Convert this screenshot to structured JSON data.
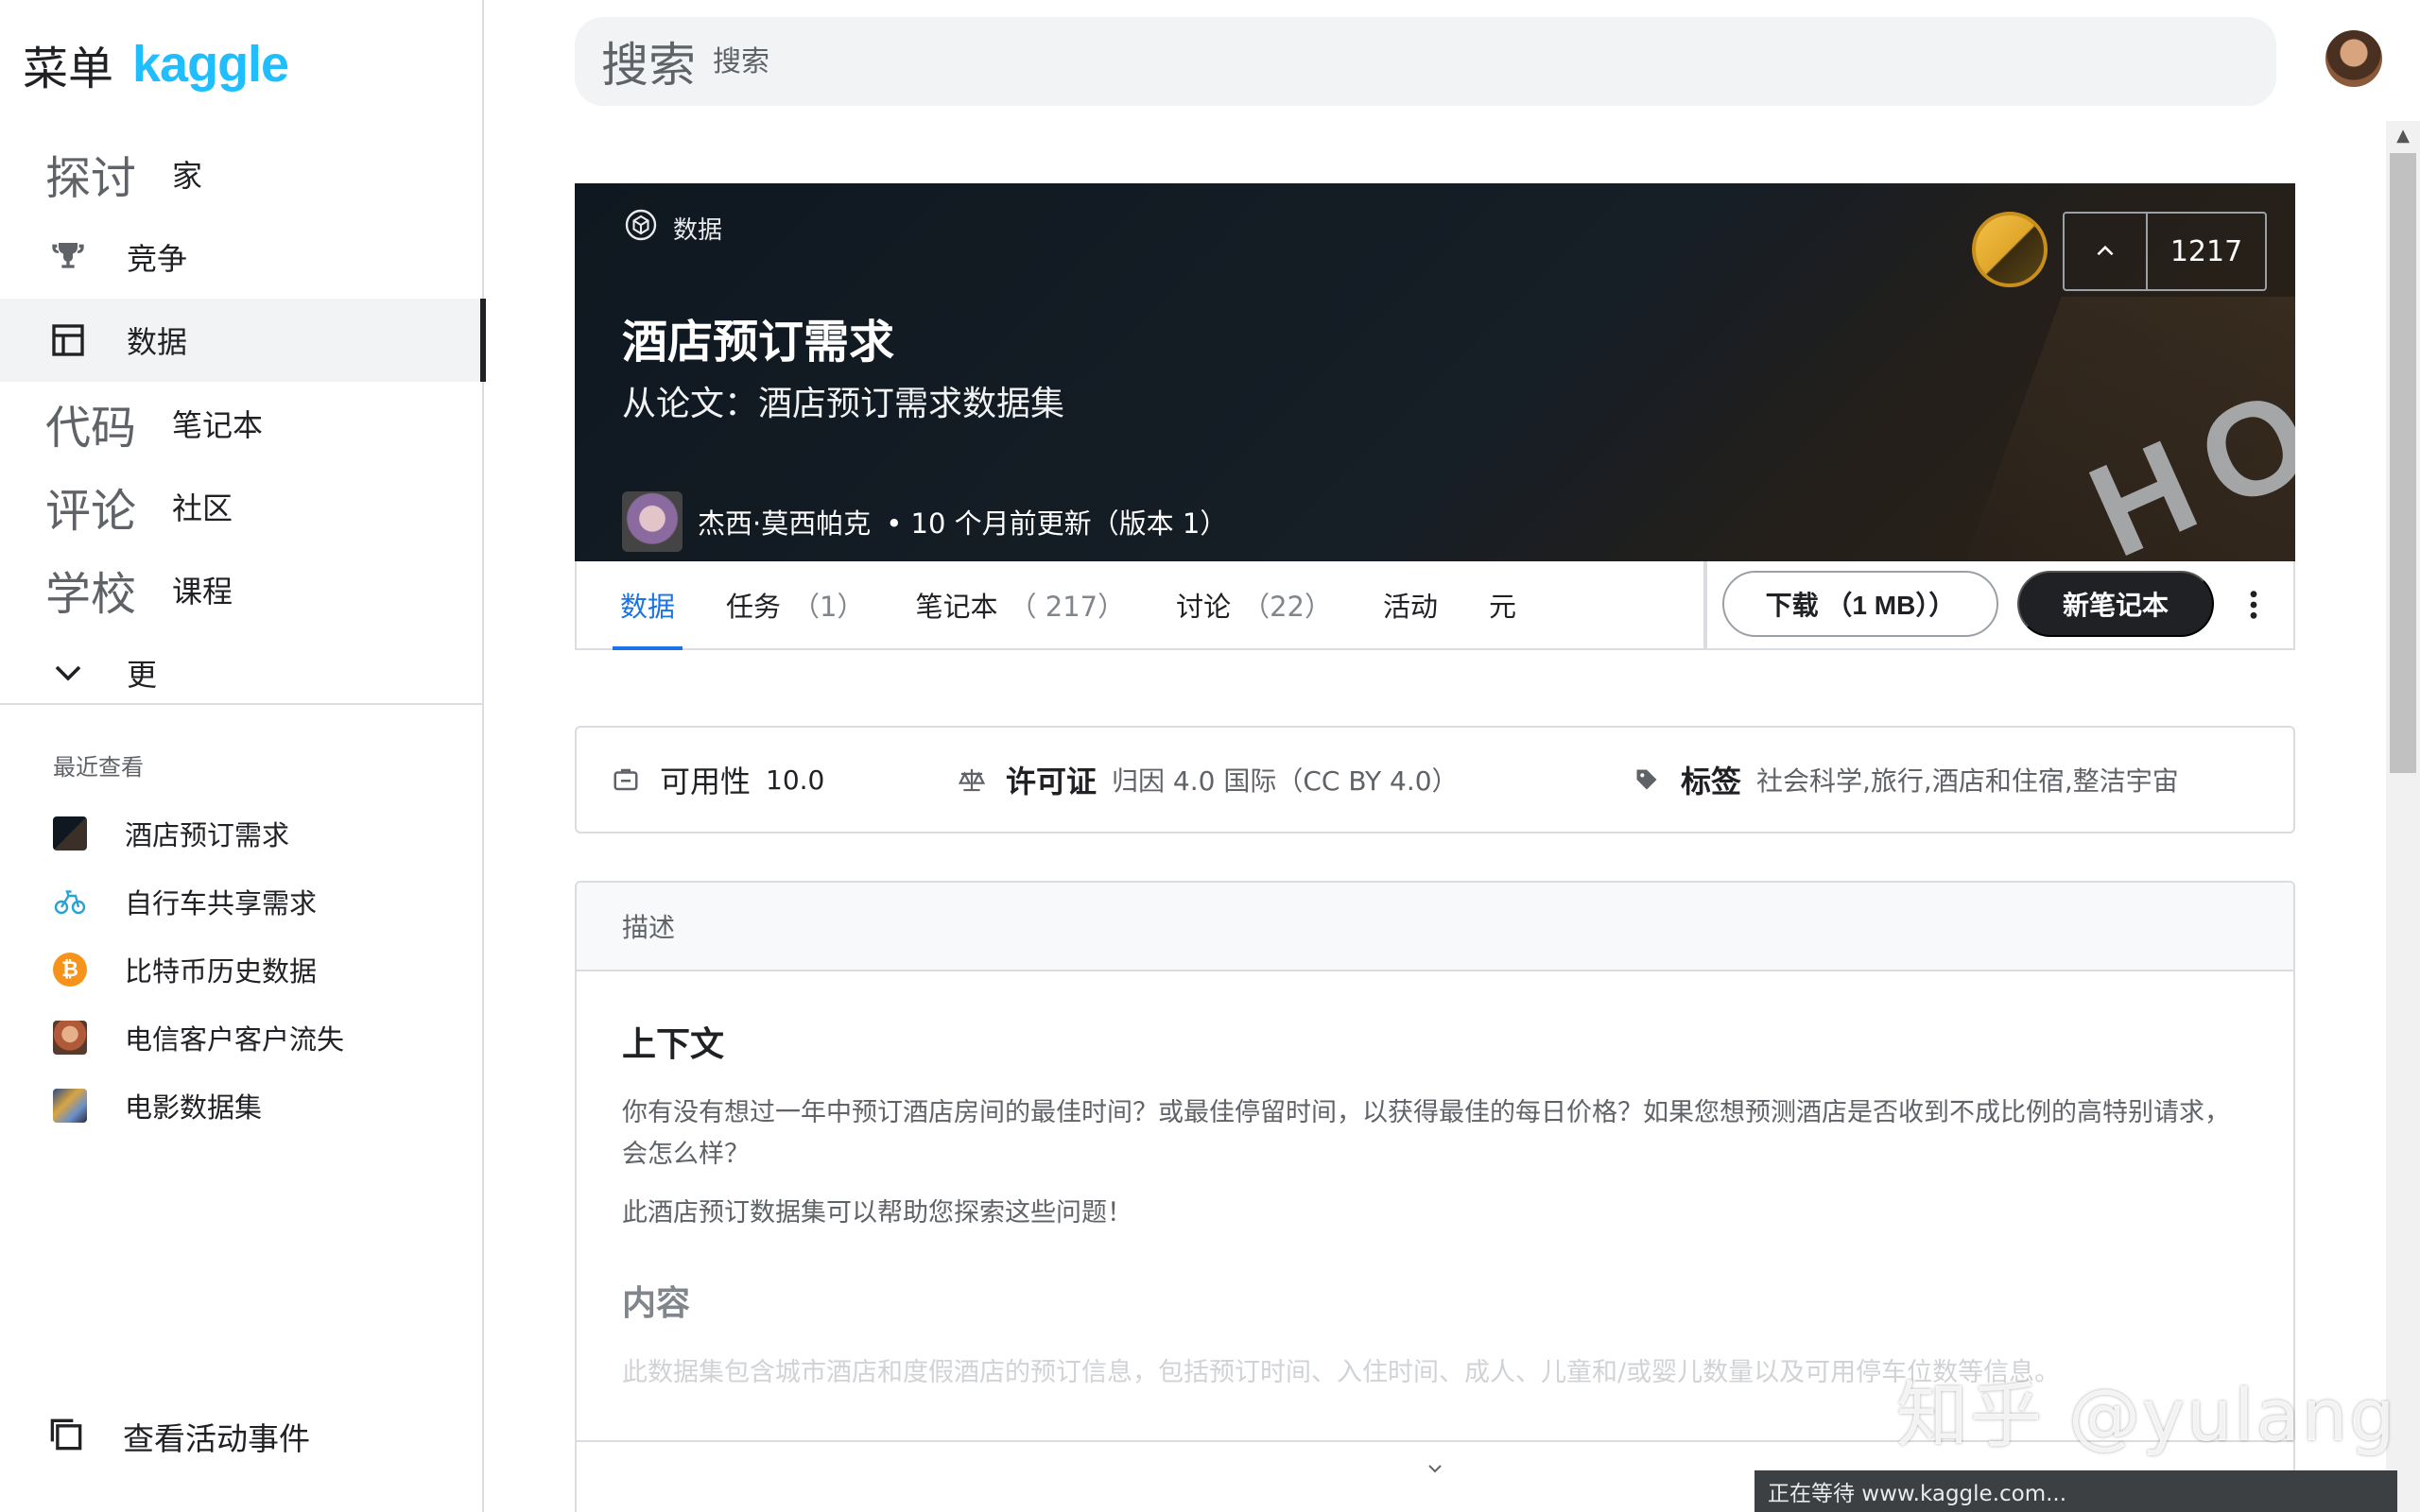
{
  "sidebar": {
    "menu_label": "菜单",
    "logo_text": "kaggle",
    "nav": [
      {
        "big": "探讨",
        "label": "家"
      },
      {
        "icon": "trophy-icon",
        "label": "竞争"
      },
      {
        "icon": "table-icon",
        "label": "数据",
        "active": true
      },
      {
        "big": "代码",
        "label": "笔记本"
      },
      {
        "big": "评论",
        "label": "社区"
      },
      {
        "big": "学校",
        "label": "课程"
      },
      {
        "icon": "chevron-down-icon",
        "label": "更"
      }
    ],
    "recent_heading": "最近查看",
    "recent": [
      {
        "label": "酒店预订需求"
      },
      {
        "label": "自行车共享需求"
      },
      {
        "label": "比特币历史数据"
      },
      {
        "label": "电信客户客户流失"
      },
      {
        "label": "电影数据集"
      }
    ],
    "footer_label": "查看活动事件"
  },
  "search": {
    "big_label": "搜索",
    "placeholder": "搜索"
  },
  "dataset": {
    "tag": "数据",
    "title": "酒店预订需求",
    "subtitle": "从论文：酒店预订需求数据集",
    "author": "杰西·莫西帕克",
    "updated": "• 10 个月前更新（版本 1）",
    "votes": "1217",
    "banner_sign": "HOTEL"
  },
  "tabs": [
    {
      "label": "数据",
      "count": "",
      "active": true
    },
    {
      "label": "任务",
      "count": "（1）"
    },
    {
      "label": "笔记本",
      "count": "（ 217）"
    },
    {
      "label": "讨论",
      "count": "（22）"
    },
    {
      "label": "活动",
      "count": ""
    },
    {
      "label": "元",
      "count": ""
    }
  ],
  "actions": {
    "download": "下载 （1 MB））",
    "new_notebook": "新笔记本"
  },
  "meta": {
    "usability_label": "可用性",
    "usability_value": "10.0",
    "license_label": "许可证",
    "license_value": "归因 4.0 国际（CC BY 4.0）",
    "tags_label": "标签",
    "tags_value": "社会科学,旅行,酒店和住宿,整洁宇宙"
  },
  "description": {
    "header": "描述",
    "h1": "上下文",
    "p1": "你有没有想过一年中预订酒店房间的最佳时间？或最佳停留时间，以获得最佳的每日价格？如果您想预测酒店是否收到不成比例的高特别请求，会怎么样？",
    "p2": "此酒店预订数据集可以帮助您探索这些问题！",
    "h2": "内容",
    "p3": "此数据集包含城市酒店和度假酒店的预订信息，包括预订时间、入住时间、成人、儿童和/或婴儿数量以及可用停车位数等信息。"
  },
  "status_text": "正在等待 www.kaggle.com...",
  "watermark": "知乎 @yulang",
  "colors": {
    "kaggle_blue": "#20beff",
    "tab_active": "#1a73e8",
    "button_dark": "#202124",
    "banner_bg": "#161e26",
    "medal_gold": "#e0a72a"
  }
}
